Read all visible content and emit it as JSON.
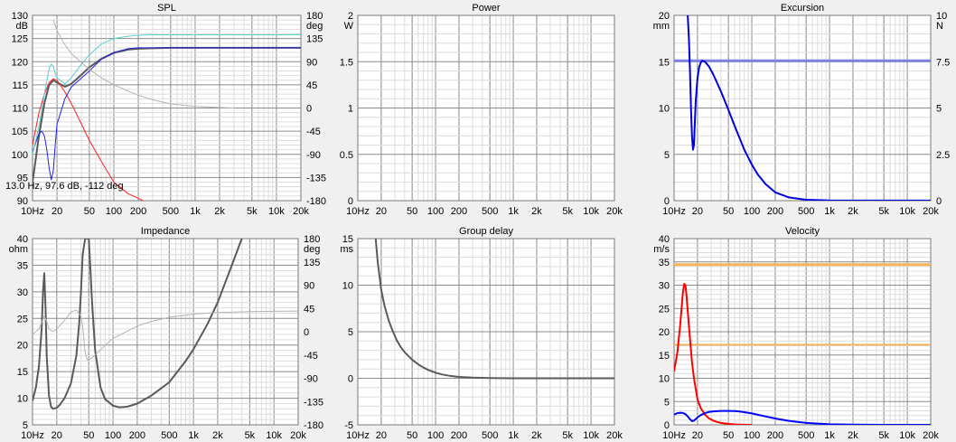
{
  "chart_data": [
    {
      "type": "line",
      "title": "SPL",
      "xscale": "log",
      "xlim": [
        10,
        20000
      ],
      "x_ticks": [
        "10Hz",
        "20",
        "50",
        "100",
        "200",
        "500",
        "1k",
        "2k",
        "5k",
        "10k",
        "20k"
      ],
      "ylim": [
        90,
        130
      ],
      "y_ticks": [
        "90",
        "95",
        "100",
        "105",
        "110",
        "115",
        "120",
        "125",
        "130"
      ],
      "yunit": "dB",
      "y2lim": [
        -180,
        180
      ],
      "y2_ticks": [
        "-180",
        "-135",
        "-90",
        "-45",
        "0",
        "45",
        "90",
        "135",
        "180"
      ],
      "y2unit": "deg",
      "grid": true,
      "annotation": "13.0 Hz, 97.6 dB, -112 deg",
      "series": [
        {
          "color": "#5a5a5a",
          "axis": "y",
          "width": 2,
          "x": [
            10,
            12,
            14,
            16,
            18,
            20,
            25,
            30,
            40,
            50,
            70,
            100,
            150,
            200,
            300,
            500,
            1000,
            2000,
            5000,
            10000,
            20000
          ],
          "y": [
            94,
            104,
            111,
            115,
            116,
            115.5,
            114.6,
            115.2,
            117.2,
            118.8,
            120.6,
            121.9,
            122.6,
            122.8,
            122.9,
            123,
            123,
            123,
            123,
            123,
            123
          ]
        },
        {
          "color": "#ff2020",
          "axis": "y",
          "width": 1,
          "x": [
            10,
            12,
            14,
            16,
            18,
            20,
            25,
            30,
            40,
            50,
            70,
            100,
            150,
            200,
            300
          ],
          "y": [
            102,
            109,
            113,
            115.5,
            116.3,
            116,
            113.5,
            111,
            106.5,
            103,
            98.5,
            94,
            91.5,
            90.5,
            89
          ]
        },
        {
          "color": "#2020e0",
          "axis": "y",
          "width": 1,
          "x": [
            10,
            12,
            13,
            14,
            15,
            16,
            17,
            18,
            19,
            20,
            25,
            30,
            40,
            50,
            70,
            100,
            150,
            200,
            300,
            500,
            1000,
            20000
          ],
          "y": [
            100.5,
            104.5,
            105,
            104,
            101,
            97,
            94.5,
            96.5,
            102,
            106.5,
            112,
            114.5,
            116.5,
            118,
            120.5,
            122,
            122.8,
            123,
            123,
            123,
            123,
            123
          ]
        },
        {
          "color": "#5ad2d2",
          "axis": "y",
          "width": 1,
          "x": [
            10,
            12,
            14,
            16,
            17,
            18,
            19,
            20,
            25,
            30,
            40,
            50,
            70,
            100,
            150,
            200,
            300,
            500,
            1000,
            20000
          ],
          "y": [
            100,
            106,
            113,
            118.5,
            119.5,
            119,
            117.5,
            116.5,
            115.2,
            116.5,
            119.5,
            121.5,
            123.8,
            125,
            125.5,
            125.7,
            125.8,
            125.8,
            125.8,
            125.8
          ]
        },
        {
          "color": "#b4b4b4",
          "axis": "y2",
          "width": 1,
          "x": [
            18,
            20,
            25,
            30,
            40,
            50,
            70,
            100,
            150,
            200,
            300,
            500,
            1000,
            2000,
            3000
          ],
          "y": [
            172,
            150,
            123,
            106,
            88,
            75,
            59,
            45,
            33,
            25,
            16,
            8,
            3,
            1,
            0
          ]
        }
      ]
    },
    {
      "type": "line",
      "title": "Power",
      "xscale": "log",
      "xlim": [
        10,
        20000
      ],
      "x_ticks": [
        "10Hz",
        "20",
        "50",
        "100",
        "200",
        "500",
        "1k",
        "2k",
        "5k",
        "10k",
        "20k"
      ],
      "ylim": [
        0,
        2
      ],
      "y_ticks": [
        "0",
        "0.5",
        "1",
        "1.5",
        "2"
      ],
      "yunit": "W",
      "grid": true,
      "series": []
    },
    {
      "type": "line",
      "title": "Excursion",
      "xscale": "log",
      "xlim": [
        10,
        20000
      ],
      "x_ticks": [
        "10Hz",
        "20",
        "50",
        "100",
        "200",
        "500",
        "1k",
        "2k",
        "5k",
        "10k",
        "20k"
      ],
      "ylim": [
        0,
        20
      ],
      "y_ticks": [
        "0",
        "5",
        "10",
        "15",
        "20"
      ],
      "yunit": "mm",
      "y2lim": [
        0,
        10
      ],
      "y2_ticks": [
        "0",
        "2.5",
        "5",
        "7.5",
        "10"
      ],
      "y2unit": "N",
      "grid": true,
      "series": [
        {
          "color": "#8080e0",
          "axis": "y",
          "width": 3,
          "x": [
            10,
            20000
          ],
          "y": [
            15.1,
            15.1
          ]
        },
        {
          "color": "#0000e0",
          "axis": "y",
          "width": 2,
          "x": [
            15,
            15.5,
            16,
            16.5,
            17,
            17.5,
            18,
            18.5,
            19,
            20,
            21,
            22,
            23,
            25,
            28,
            32,
            40,
            50,
            60,
            70,
            80,
            100,
            120,
            150,
            200,
            300,
            500,
            1000,
            2000,
            20000
          ],
          "y": [
            20,
            17.5,
            14,
            10,
            7,
            5.5,
            6,
            8.5,
            10.8,
            13.2,
            14.4,
            14.9,
            15.1,
            15,
            14.5,
            13.6,
            11.8,
            9.8,
            8.1,
            6.7,
            5.5,
            3.9,
            2.8,
            1.8,
            0.9,
            0.35,
            0.1,
            0.02,
            0.01,
            0.01
          ]
        }
      ]
    },
    {
      "type": "line",
      "title": "Impedance",
      "xscale": "log",
      "xlim": [
        10,
        20000
      ],
      "x_ticks": [
        "10Hz",
        "20",
        "50",
        "100",
        "200",
        "500",
        "1k",
        "2k",
        "5k",
        "10k",
        "20k"
      ],
      "ylim": [
        5,
        40
      ],
      "y_ticks": [
        "5",
        "10",
        "15",
        "20",
        "25",
        "30",
        "35",
        "40"
      ],
      "yunit": "ohm",
      "y2lim": [
        -180,
        180
      ],
      "y2_ticks": [
        "-180",
        "-135",
        "-90",
        "-45",
        "0",
        "45",
        "90",
        "135",
        "180"
      ],
      "y2unit": "deg",
      "grid": true,
      "series": [
        {
          "color": "#5a5a5a",
          "axis": "y",
          "width": 2,
          "x": [
            10,
            11,
            12,
            13,
            13.5,
            14,
            14.5,
            15,
            16,
            17,
            18,
            20,
            22,
            25,
            30,
            35,
            38,
            40,
            42,
            45,
            50,
            55,
            60,
            70,
            80,
            100,
            120,
            150,
            200,
            300,
            500,
            800,
            1000,
            1500,
            2000,
            3000,
            5000,
            7000,
            10000
          ],
          "y": [
            9.5,
            12,
            16,
            23,
            30,
            33.5,
            27,
            18,
            10.5,
            8.4,
            8,
            8.2,
            8.8,
            10,
            12.8,
            18,
            24,
            30,
            37,
            40,
            40,
            28,
            19,
            12,
            9.8,
            8.6,
            8.3,
            8.4,
            9,
            10.5,
            13,
            17,
            19.2,
            24,
            28,
            35,
            44,
            52,
            60
          ]
        },
        {
          "color": "#b4b4b4",
          "axis": "y2",
          "width": 1,
          "x": [
            10,
            12,
            13,
            14,
            15,
            16,
            18,
            20,
            25,
            30,
            35,
            40,
            42,
            45,
            48,
            50,
            55,
            60,
            70,
            80,
            100,
            150,
            200,
            300,
            500,
            1000,
            2000,
            5000,
            10000,
            20000
          ],
          "y": [
            -5,
            5,
            18,
            30,
            20,
            5,
            0,
            5,
            22,
            38,
            42,
            30,
            10,
            -40,
            -55,
            -55,
            -50,
            -45,
            -35,
            -26,
            -13,
            1,
            11,
            20,
            28,
            34,
            37,
            39,
            39.5,
            40
          ]
        }
      ]
    },
    {
      "type": "line",
      "title": "Group delay",
      "xscale": "log",
      "xlim": [
        10,
        20000
      ],
      "x_ticks": [
        "10Hz",
        "20",
        "50",
        "100",
        "200",
        "500",
        "1k",
        "2k",
        "5k",
        "10k",
        "20k"
      ],
      "ylim": [
        -5,
        15
      ],
      "y_ticks": [
        "-5",
        "0",
        "5",
        "10",
        "15"
      ],
      "yunit": "ms",
      "grid": true,
      "series": [
        {
          "color": "#5a5a5a",
          "axis": "y",
          "width": 2,
          "x": [
            17,
            18,
            20,
            22,
            25,
            28,
            32,
            36,
            40,
            50,
            60,
            70,
            80,
            100,
            120,
            150,
            200,
            300,
            500,
            1000,
            20000
          ],
          "y": [
            15,
            12.5,
            9.5,
            7.8,
            6.2,
            5.1,
            4,
            3.3,
            2.8,
            2,
            1.5,
            1.15,
            0.9,
            0.6,
            0.42,
            0.27,
            0.15,
            0.07,
            0.02,
            0,
            0
          ]
        }
      ]
    },
    {
      "type": "line",
      "title": "Velocity",
      "xscale": "log",
      "xlim": [
        10,
        20000
      ],
      "x_ticks": [
        "10Hz",
        "20",
        "50",
        "100",
        "200",
        "500",
        "1k",
        "2k",
        "5k",
        "10k",
        "20k"
      ],
      "ylim": [
        0,
        40
      ],
      "y_ticks": [
        "0",
        "5",
        "10",
        "15",
        "20",
        "25",
        "30",
        "35",
        "40"
      ],
      "yunit": "m/s",
      "grid": true,
      "series": [
        {
          "color": "#f5b45a",
          "axis": "y",
          "width": 3,
          "x": [
            10,
            20000
          ],
          "y": [
            34.4,
            34.4
          ]
        },
        {
          "color": "#f5b45a",
          "axis": "y",
          "width": 2,
          "x": [
            10,
            20000
          ],
          "y": [
            17.2,
            17.2
          ]
        },
        {
          "color": "#ff0000",
          "axis": "y",
          "width": 2,
          "x": [
            10,
            11,
            12,
            13,
            13.5,
            14,
            14.5,
            15,
            16,
            17,
            18,
            20,
            22,
            25,
            28,
            32,
            36,
            40,
            50,
            60,
            70,
            80,
            100
          ],
          "y": [
            11.5,
            15.5,
            21.5,
            28.5,
            30.3,
            30,
            27.5,
            24.5,
            18.5,
            13.5,
            10,
            5.5,
            3.6,
            2.2,
            1.4,
            0.9,
            0.6,
            0.4,
            0.2,
            0.1,
            0.05,
            0.02,
            0
          ]
        },
        {
          "color": "#0000ff",
          "axis": "y",
          "width": 2,
          "x": [
            10,
            11,
            12,
            13,
            14,
            15,
            16,
            17,
            18,
            20,
            22,
            25,
            28,
            32,
            40,
            50,
            60,
            70,
            80,
            100,
            120,
            150,
            200,
            300,
            500,
            1000,
            2000,
            5000,
            20000
          ],
          "y": [
            2.2,
            2.5,
            2.6,
            2.55,
            2.3,
            1.8,
            1.2,
            0.8,
            0.9,
            1.6,
            2.1,
            2.5,
            2.75,
            2.9,
            3,
            3,
            2.95,
            2.85,
            2.72,
            2.45,
            2.15,
            1.8,
            1.35,
            0.85,
            0.4,
            0.12,
            0.03,
            0,
            0
          ]
        }
      ]
    }
  ]
}
